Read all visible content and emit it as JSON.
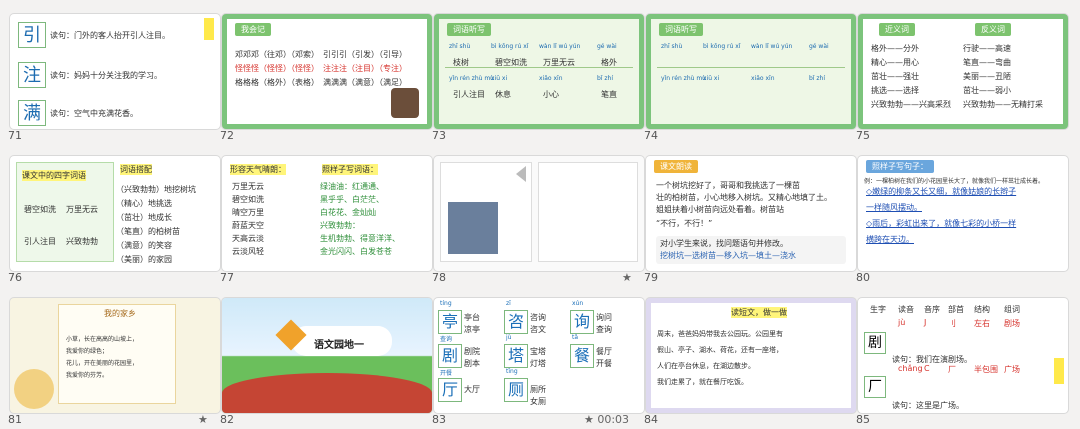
{
  "slides": [
    {
      "num": "71",
      "lines": [
        "引",
        "注",
        "满",
        "读句：门外的客人抬开引人注目。",
        "读句：妈妈十分关注我的学习。",
        "读句：空气中充满花香。"
      ]
    },
    {
      "num": "72",
      "lines": [
        "我会记",
        "邓邓邓（往邓）（邓索）",
        "怪怪怪（怪怪）（怪怪）",
        "格格格（格外）（表格）",
        "引引引（引发）（引导）",
        "注注注（注目）（专注）",
        "满满满（满意）（满足）"
      ]
    },
    {
      "num": "73",
      "lines": [
        "词语听写",
        "zhī shù",
        "bì kōng rú xǐ",
        "wàn lǐ wú yún",
        "gé wài",
        "枝树",
        "碧空如洗",
        "万里无云",
        "格外",
        "yǐn rén zhù mù",
        "xiū xi",
        "xiǎo xīn",
        "bǐ zhí",
        "引人注目",
        "休息",
        "小心",
        "笔直"
      ]
    },
    {
      "num": "74",
      "lines": [
        "词语听写",
        "zhī shù",
        "bì kōng rú xǐ",
        "wàn lǐ wú yún",
        "gé wài",
        "yǐn rén zhù mù",
        "xiū xi",
        "xiǎo xīn",
        "bǐ zhí"
      ]
    },
    {
      "num": "75",
      "lines": [
        "近义词",
        "反义词",
        "格外——分外",
        "精心——用心",
        "茁壮——强壮",
        "挑选——选择",
        "兴致勃勃——兴高采烈",
        "行驶——高速",
        "笔直——弯曲",
        "美丽——丑陋",
        "茁壮——弱小",
        "兴致勃勃——无精打采"
      ]
    },
    {
      "num": "76",
      "lines": [
        "课文中的四字词语",
        "碧空如洗",
        "万里无云",
        "引人注目",
        "兴致勃勃",
        "词语搭配",
        "（兴致勃勃）地挖树坑",
        "（精心）地挑选",
        "（茁壮）地成长",
        "（笔直）的柏树苗",
        "（满意）的笑容",
        "（美丽）的家园"
      ]
    },
    {
      "num": "77",
      "lines": [
        "形容天气晴朗：",
        "万里无云",
        "碧空如洗",
        "晴空万里",
        "蔚蓝天空",
        "天高云淡",
        "云淡风轻",
        "照样子写词语：",
        "绿油油：红通通、",
        "黑乎乎、白茫茫、",
        "白花花、金灿灿",
        "兴致勃勃：",
        "生机勃勃、得意洋洋、",
        "金光闪闪、白发苍苍"
      ]
    },
    {
      "num": "78",
      "lines": []
    },
    {
      "num": "79",
      "lines": [
        "课文朗读",
        "一个树坑挖好了，哥哥和我挑选了一棵茁",
        "壮的柏树苗，小心地移入树坑。又精心地填了土。",
        "姐姐扶着小树苗向远处看着。树苗站",
        "“不行，不行！”",
        "对小学生来说，找问题语句并修改。",
        "挖树坑—选树苗—移入坑—填土—浇水"
      ]
    },
    {
      "num": "80",
      "lines": [
        "照样子写句子：",
        "例：一棵柏树在我们的小花园里长大了，就像我们一样茁壮成长着。",
        "◇嫩绿的柳条又长又细，就像姑娘的长辫子",
        "一样随风摆动。",
        "◇雨后，彩虹出来了，就像七彩的小桥一样",
        "横跨在天边。"
      ]
    },
    {
      "num": "81",
      "lines": [
        "我的家乡",
        "小草，长在高高的山坡上，",
        "我爱你的绿色；",
        "花儿，开在美丽的花园里，",
        "我爱你的芬芳。"
      ]
    },
    {
      "num": "82",
      "lines": [
        "语文园地一"
      ]
    },
    {
      "num": "83",
      "lines": [
        "tíng",
        "zī",
        "xún",
        "亭台",
        "咨询",
        "询问",
        "凉亭",
        "咨文",
        "查询",
        "jù",
        "tǎ",
        "cān",
        "剧院",
        "宝塔",
        "餐厅",
        "剧本",
        "灯塔",
        "开餐",
        "tīng",
        "cè",
        "厕所",
        "大厅",
        "客厅",
        "女厕"
      ]
    },
    {
      "num": "84",
      "lines": [
        "读短文，做一做",
        "周末，爸爸妈妈带我去公园玩。公园里有",
        "假山、亭子、湖水、荷花，还有一座塔，",
        "人们在亭台休息，在湖边散步。",
        "我们走累了，就在餐厅吃饭。"
      ]
    },
    {
      "num": "85",
      "lines": [
        "生字",
        "读音",
        "音序",
        "部首",
        "结构",
        "组词",
        "剧",
        "jù",
        "J",
        "刂",
        "左右",
        "剧场",
        "厂",
        "chǎng",
        "C",
        "厂",
        "半包围",
        "广场",
        "读句：我们在演剧场。",
        "读句：这里是广场。"
      ]
    }
  ],
  "timers": {
    "slide83": "00:03"
  }
}
